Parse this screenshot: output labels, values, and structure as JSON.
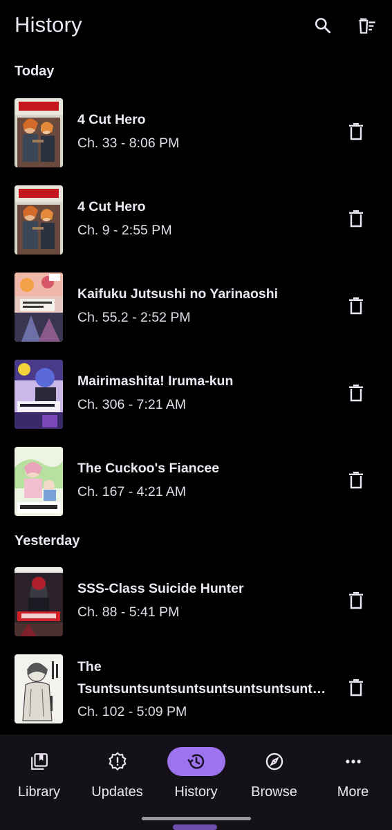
{
  "header": {
    "title": "History",
    "search_icon": "search-icon",
    "clear_icon": "clear-all-icon"
  },
  "sections": [
    {
      "label": "Today",
      "items": [
        {
          "title": "4 Cut Hero",
          "subtitle": "Ch. 33 - 8:06 PM"
        },
        {
          "title": "4 Cut Hero",
          "subtitle": "Ch. 9 - 2:55 PM"
        },
        {
          "title": "Kaifuku Jutsushi no Yarinaoshi",
          "subtitle": "Ch. 55.2 - 2:52 PM"
        },
        {
          "title": "Mairimashita! Iruma-kun",
          "subtitle": "Ch. 306 - 7:21 AM"
        },
        {
          "title": "The Cuckoo's Fiancee",
          "subtitle": "Ch. 167 - 4:21 AM"
        }
      ]
    },
    {
      "label": "Yesterday",
      "items": [
        {
          "title": "SSS-Class Suicide Hunter",
          "subtitle": "Ch. 88 - 5:41 PM"
        },
        {
          "title_line1": "The",
          "title_line2": "Tsuntsuntsuntsuntsuntsuntsuntsuntsun...",
          "subtitle": "Ch. 102 - 5:09 PM"
        }
      ]
    }
  ],
  "nav": {
    "items": [
      {
        "label": "Library",
        "icon": "library-icon"
      },
      {
        "label": "Updates",
        "icon": "updates-icon"
      },
      {
        "label": "History",
        "icon": "history-icon",
        "active": true
      },
      {
        "label": "Browse",
        "icon": "browse-icon"
      },
      {
        "label": "More",
        "icon": "more-icon"
      }
    ]
  },
  "colors": {
    "background": "#000000",
    "nav_background": "#141218",
    "accent": "#9d73f0",
    "text": "#ece7f2"
  }
}
